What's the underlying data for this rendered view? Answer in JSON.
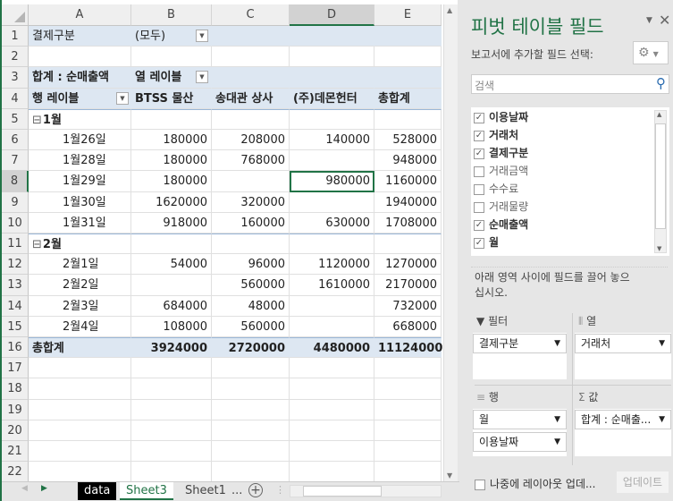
{
  "columns": [
    "A",
    "B",
    "C",
    "D",
    "E"
  ],
  "rows": [
    {
      "n": "1",
      "cells": [
        "결제구분",
        "(모두)",
        "",
        "",
        ""
      ]
    },
    {
      "n": "2",
      "cells": [
        "",
        "",
        "",
        "",
        ""
      ]
    },
    {
      "n": "3",
      "cells": [
        "합계 : 순매출액",
        "열 레이블",
        "",
        "",
        ""
      ]
    },
    {
      "n": "4",
      "cells": [
        "행 레이블",
        "BTSS 물산",
        "송대관 상사",
        "(주)데몬헌터",
        "총합계"
      ]
    },
    {
      "n": "5",
      "cells": [
        "1월",
        "",
        "",
        "",
        ""
      ]
    },
    {
      "n": "6",
      "cells": [
        "1월26일",
        "180000",
        "208000",
        "140000",
        "528000"
      ]
    },
    {
      "n": "7",
      "cells": [
        "1월28일",
        "180000",
        "768000",
        "",
        "948000"
      ]
    },
    {
      "n": "8",
      "cells": [
        "1월29일",
        "180000",
        "",
        "980000",
        "1160000"
      ]
    },
    {
      "n": "9",
      "cells": [
        "1월30일",
        "1620000",
        "320000",
        "",
        "1940000"
      ]
    },
    {
      "n": "10",
      "cells": [
        "1월31일",
        "918000",
        "160000",
        "630000",
        "1708000"
      ]
    },
    {
      "n": "11",
      "cells": [
        "2월",
        "",
        "",
        "",
        ""
      ]
    },
    {
      "n": "12",
      "cells": [
        "2월1일",
        "54000",
        "96000",
        "1120000",
        "1270000"
      ]
    },
    {
      "n": "13",
      "cells": [
        "2월2일",
        "",
        "560000",
        "1610000",
        "2170000"
      ]
    },
    {
      "n": "14",
      "cells": [
        "2월3일",
        "684000",
        "48000",
        "",
        "732000"
      ]
    },
    {
      "n": "15",
      "cells": [
        "2월4일",
        "108000",
        "560000",
        "",
        "668000"
      ]
    },
    {
      "n": "16",
      "cells": [
        "총합계",
        "3924000",
        "2720000",
        "4480000",
        "11124000"
      ]
    },
    {
      "n": "17",
      "cells": [
        "",
        "",
        "",
        "",
        ""
      ]
    },
    {
      "n": "18",
      "cells": [
        "",
        "",
        "",
        "",
        ""
      ]
    },
    {
      "n": "19",
      "cells": [
        "",
        "",
        "",
        "",
        ""
      ]
    },
    {
      "n": "20",
      "cells": [
        "",
        "",
        "",
        "",
        ""
      ]
    },
    {
      "n": "21",
      "cells": [
        "",
        "",
        "",
        "",
        ""
      ]
    },
    {
      "n": "22",
      "cells": [
        "",
        "",
        "",
        "",
        ""
      ]
    }
  ],
  "tabs": {
    "data": "data",
    "sheet3": "Sheet3",
    "sheet1": "Sheet1",
    "more": "..."
  },
  "panel": {
    "title": "피벗 테이블 필드",
    "subtitle": "보고서에 추가할 필드 선택:",
    "search_placeholder": "검색",
    "fields": [
      {
        "label": "이용날짜",
        "checked": true
      },
      {
        "label": "거래처",
        "checked": true
      },
      {
        "label": "결제구분",
        "checked": true
      },
      {
        "label": "거래금액",
        "checked": false
      },
      {
        "label": "수수료",
        "checked": false
      },
      {
        "label": "거래물량",
        "checked": false
      },
      {
        "label": "순매출액",
        "checked": true
      },
      {
        "label": "월",
        "checked": true
      }
    ],
    "drag_hint": "아래 영역 사이에 필드를 끌어 놓으십시오.",
    "filter_label": "필터",
    "columns_label": "열",
    "rows_label": "행",
    "values_label": "값",
    "filter_items": [
      "결제구분"
    ],
    "column_items": [
      "거래처"
    ],
    "row_items": [
      "월",
      "이용날짜"
    ],
    "value_items": [
      "합계 : 순매출..."
    ],
    "defer_label": "나중에 레이아웃 업데...",
    "update_label": "업데이트"
  }
}
